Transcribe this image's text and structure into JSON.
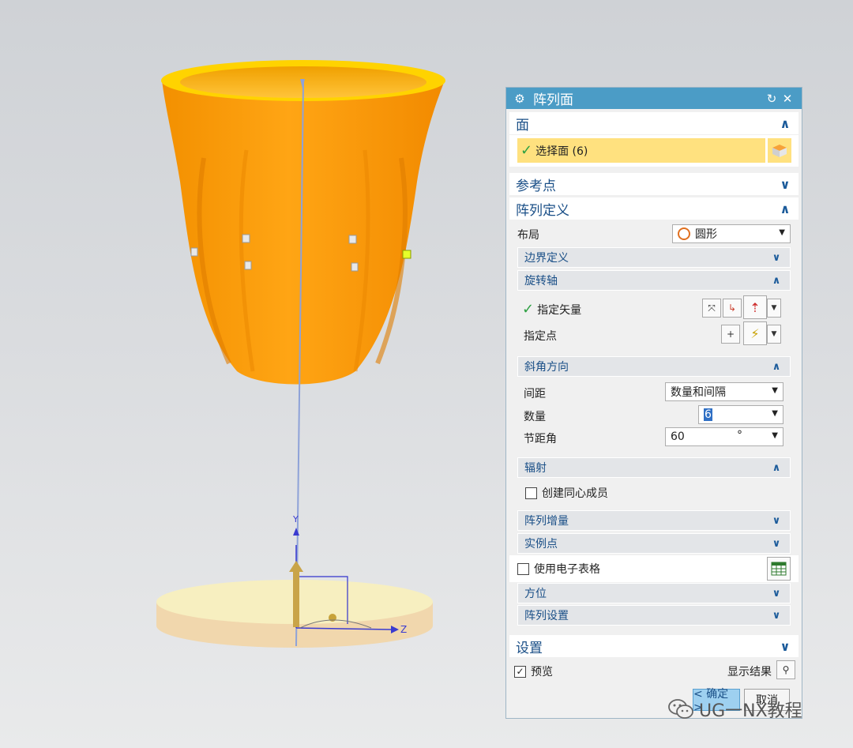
{
  "viewport": {
    "axis_label_y": "Y",
    "axis_label_z": "Z",
    "colors": {
      "cup": "#ff9f00",
      "cup_rim": "#ffd200",
      "base": "#f3deb7"
    }
  },
  "dialog": {
    "title": "阵列面",
    "title_icon": "gear-icon",
    "face_section": {
      "label": "面",
      "select_label": "选择面 (6)"
    },
    "ref_point": {
      "label": "参考点"
    },
    "array_def": {
      "label": "阵列定义",
      "layout_label": "布局",
      "layout_value": "圆形",
      "boundary_label": "边界定义",
      "rotation_axis": {
        "label": "旋转轴",
        "vector_label": "指定矢量",
        "point_label": "指定点"
      },
      "angle_dir": {
        "label": "斜角方向",
        "spacing_label": "间距",
        "spacing_value": "数量和间隔",
        "count_label": "数量",
        "count_value": "6",
        "pitch_label": "节距角",
        "pitch_value": "60",
        "pitch_unit": "°"
      },
      "radiate": {
        "label": "辐射",
        "concentric_label": "创建同心成员"
      },
      "increment_label": "阵列增量",
      "instance_label": "实例点",
      "spreadsheet_label": "使用电子表格",
      "orientation_label": "方位",
      "settings_label": "阵列设置"
    },
    "settings": {
      "label": "设置"
    },
    "preview_label": "预览",
    "show_result_label": "显示结果",
    "ok_label": "< 确定 >",
    "cancel_label": "取消"
  },
  "watermark": "UG一NX教程"
}
